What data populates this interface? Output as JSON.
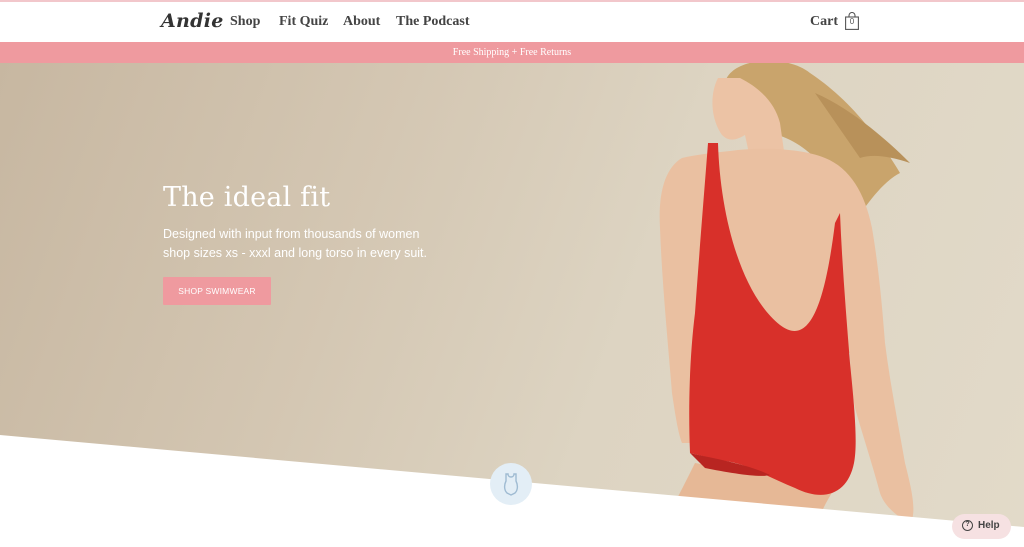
{
  "header": {
    "logo": "Andie",
    "nav": [
      "Shop",
      "Fit Quiz",
      "About",
      "The Podcast"
    ],
    "cart_label": "Cart",
    "cart_count": "0"
  },
  "promo": {
    "text": "Free Shipping + Free Returns"
  },
  "hero": {
    "title": "The ideal fit",
    "subtitle_line1": "Designed with input from thousands of women",
    "subtitle_line2": "shop sizes xs - xxxl and long torso in every suit.",
    "cta": "SHOP SWIMWEAR"
  },
  "help": {
    "label": "Help"
  },
  "colors": {
    "accent_pink": "#ef9a9f",
    "swimsuit_red": "#d8302a",
    "hero_bg": "#d4c7b3"
  },
  "icons": [
    "shopping-bag-icon",
    "swimsuit-icon",
    "help-question-icon"
  ]
}
